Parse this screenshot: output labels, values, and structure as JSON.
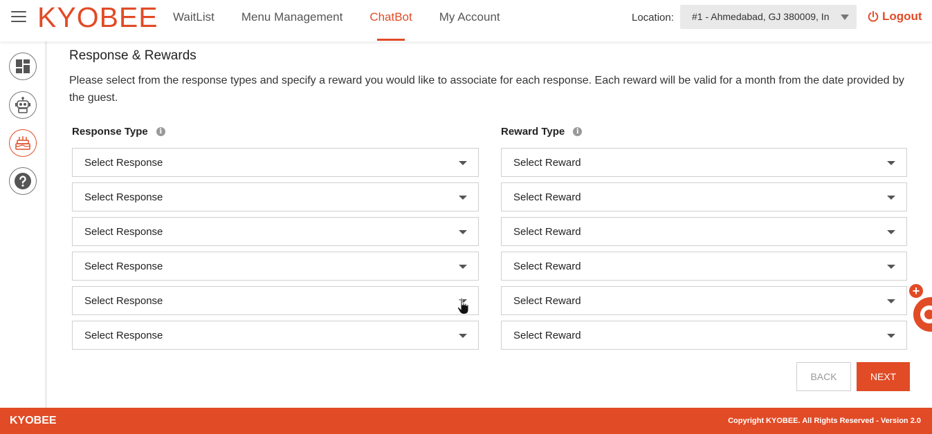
{
  "header": {
    "logo": "KYOBEE",
    "nav": [
      {
        "label": "WaitList",
        "active": false
      },
      {
        "label": "Menu Management",
        "active": false
      },
      {
        "label": "ChatBot",
        "active": true
      },
      {
        "label": "My Account",
        "active": false
      }
    ],
    "location_label": "Location:",
    "location_value": "#1 - Ahmedabad, GJ 380009, In",
    "logout_label": "Logout"
  },
  "sidebar": {
    "items": [
      {
        "icon": "dashboard-icon",
        "active": false
      },
      {
        "icon": "robot-icon",
        "active": false
      },
      {
        "icon": "cake-icon",
        "active": true
      },
      {
        "icon": "help-icon",
        "active": false
      }
    ]
  },
  "main": {
    "title": "Response & Rewards",
    "description": "Please select from the response types and specify a reward you would like to associate for each response. Each reward will be valid for a month from the date provided by the guest.",
    "response_label": "Response Type",
    "reward_label": "Reward Type",
    "info_glyph": "i",
    "rows": [
      {
        "response": "Select Response",
        "reward": "Select Reward"
      },
      {
        "response": "Select Response",
        "reward": "Select Reward"
      },
      {
        "response": "Select Response",
        "reward": "Select Reward"
      },
      {
        "response": "Select Response",
        "reward": "Select Reward"
      },
      {
        "response": "Select Response",
        "reward": "Select Reward"
      },
      {
        "response": "Select Response",
        "reward": "Select Reward"
      }
    ],
    "back_label": "BACK",
    "next_label": "NEXT"
  },
  "chat_widget": {
    "plus": "+"
  },
  "footer": {
    "brand": "KYOBEE",
    "copyright": "Copyright KYOBEE. All Rights Reserved - Version 2.0"
  },
  "colors": {
    "accent": "#e14b26"
  }
}
